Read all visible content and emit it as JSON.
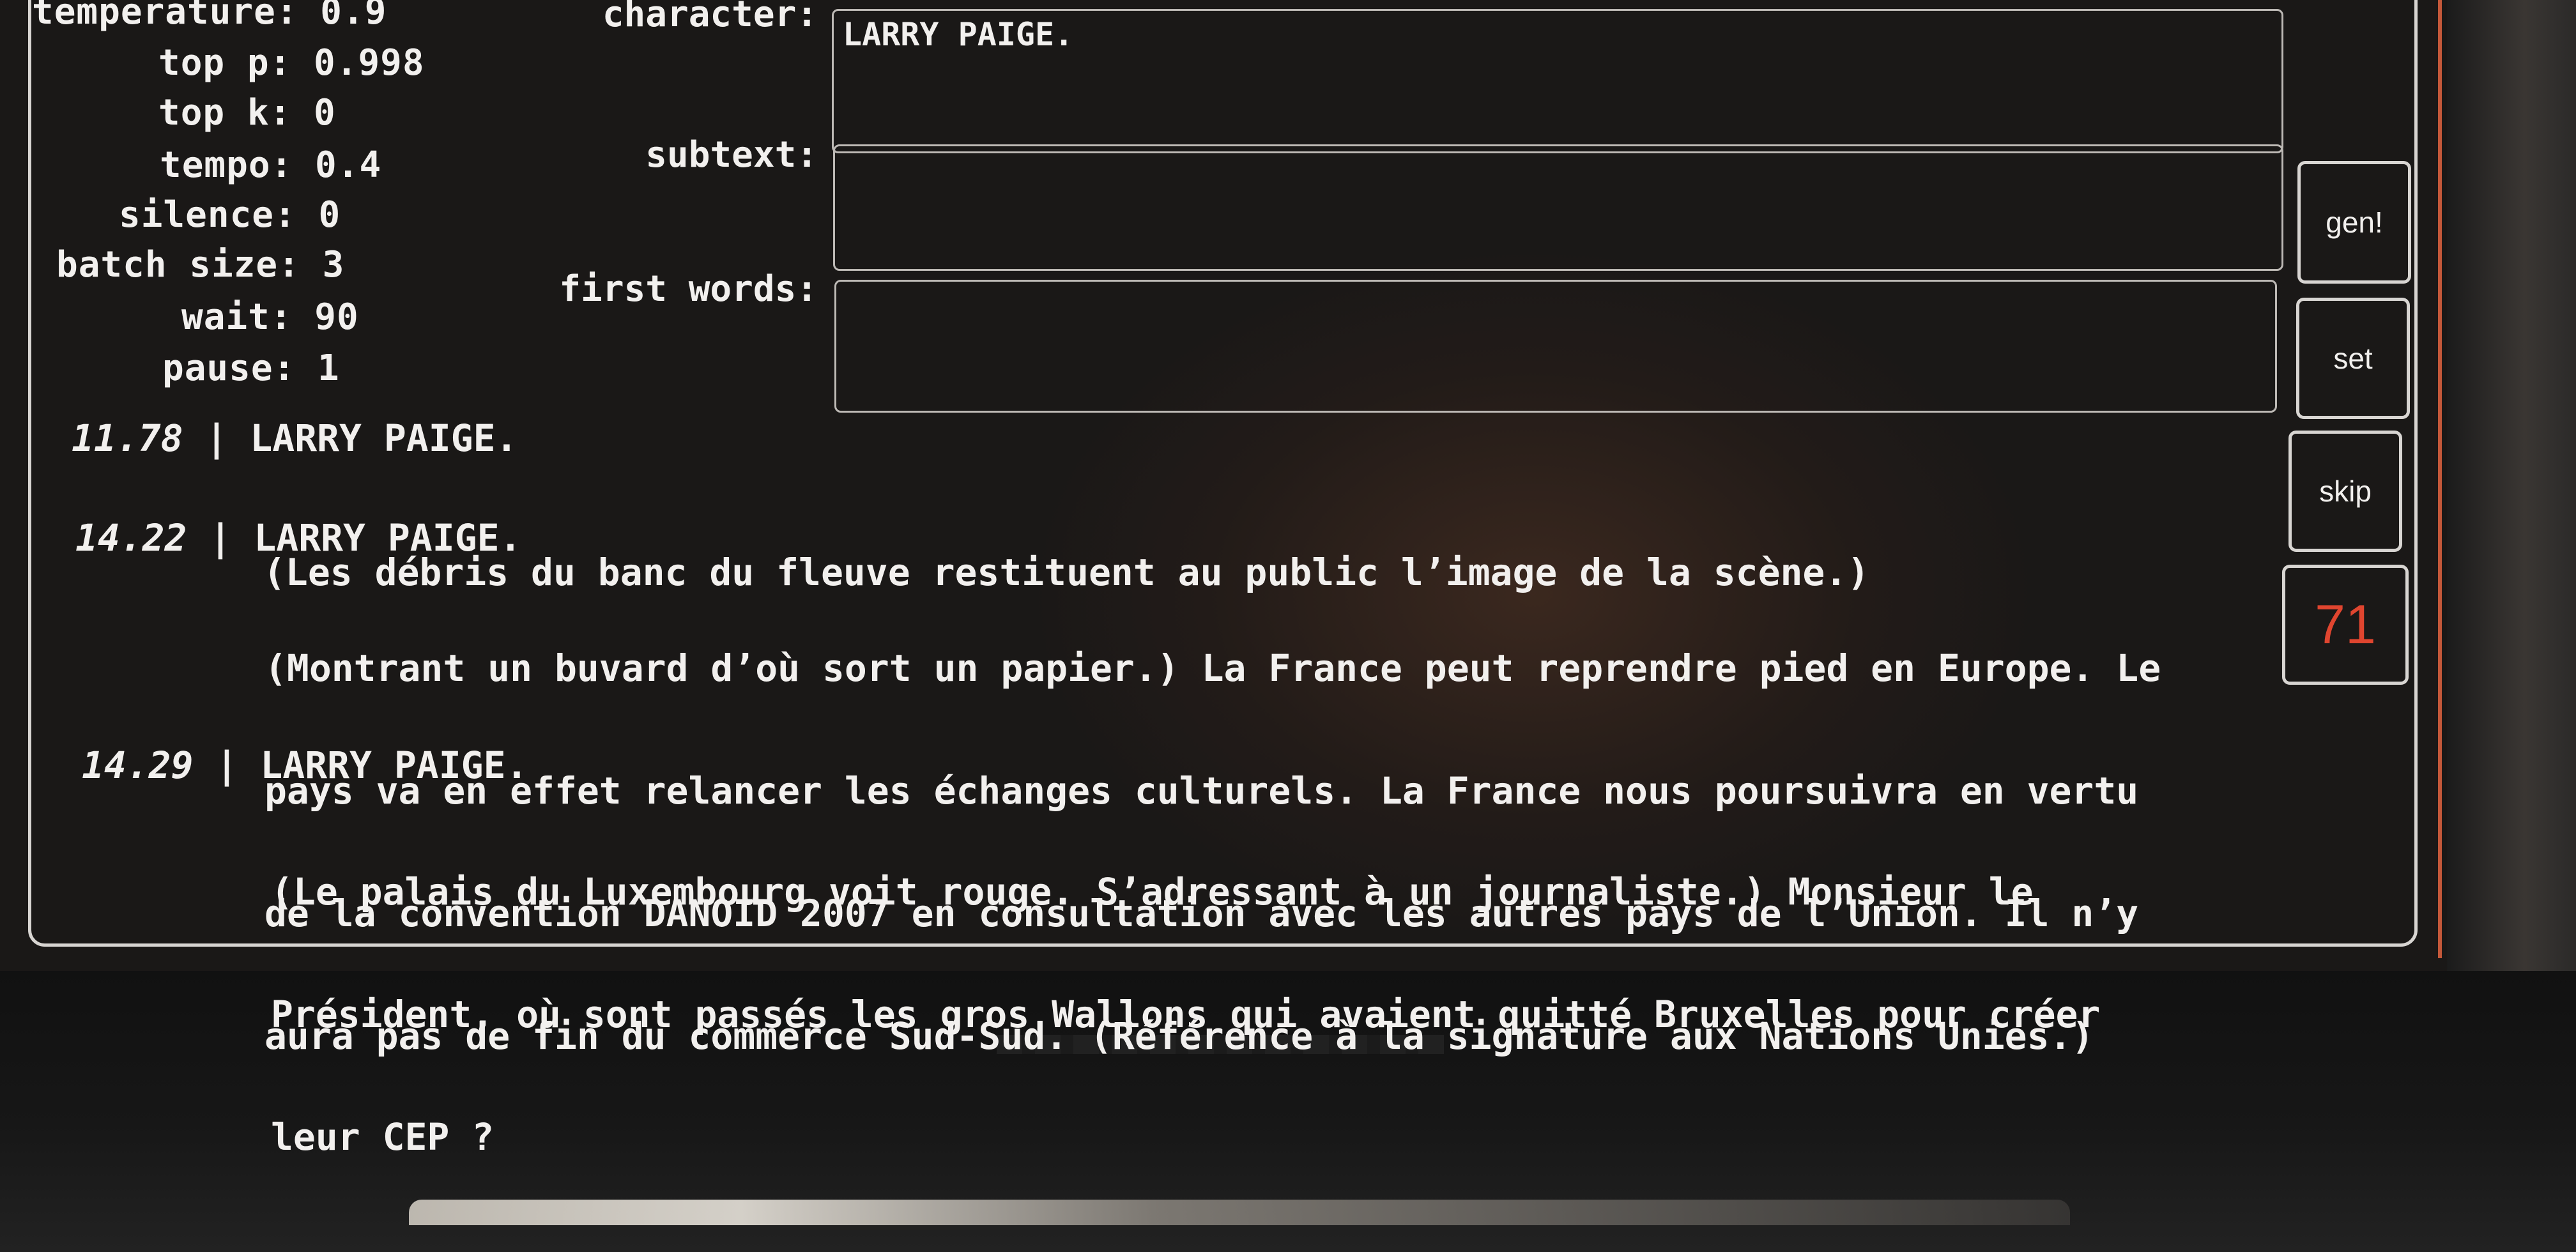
{
  "params": [
    {
      "label": "temperature:",
      "value": "0.9"
    },
    {
      "label": "top p:",
      "value": "0.998"
    },
    {
      "label": "top k:",
      "value": "0"
    },
    {
      "label": "tempo:",
      "value": "0.4"
    },
    {
      "label": "silence:",
      "value": "0"
    },
    {
      "label": "batch size:",
      "value": "3"
    },
    {
      "label": "wait:",
      "value": "90"
    },
    {
      "label": "pause:",
      "value": "1"
    }
  ],
  "fields": {
    "character": {
      "label": "character:",
      "value": "LARRY PAIGE."
    },
    "subtext": {
      "label": "subtext:",
      "value": ""
    },
    "first_words": {
      "label": "first words:",
      "value": ""
    }
  },
  "buttons": {
    "gen": "gen!",
    "set": "set",
    "skip": "skip"
  },
  "counter": "71",
  "log": [
    {
      "time": "11.78",
      "sep": "|",
      "speaker": "LARRY PAIGE.",
      "lines": [
        "(Les débris du banc du fleuve restituent au public l’image de la scène.)"
      ]
    },
    {
      "time": "14.22",
      "sep": "|",
      "speaker": "LARRY PAIGE.",
      "lines": [
        "(Montrant un buvard d’où sort un papier.) La France peut reprendre pied en Europe. Le",
        "pays va en effet relancer les échanges culturels. La France nous poursuivra en vertu",
        "de la convention DANOID 2007 en consultation avec les autres pays de l’Union. Il n’y",
        "aura pas de fin du commerce Sud-Sud. (Référence à la signature aux Nations Unies.)"
      ]
    },
    {
      "time": "14.29",
      "sep": "|",
      "speaker": "LARRY PAIGE.",
      "lines": [
        "(Le palais du Luxembourg voit rouge. S’adressant à un journaliste.) Monsieur le",
        "Président, où sont passés les gros Wallons qui avaient quitté Bruxelles pour créer",
        "leur CEP ?"
      ]
    }
  ],
  "colors": {
    "counter": "#e0452f",
    "frame": "#d8d5d2",
    "background": "#1a1817"
  }
}
